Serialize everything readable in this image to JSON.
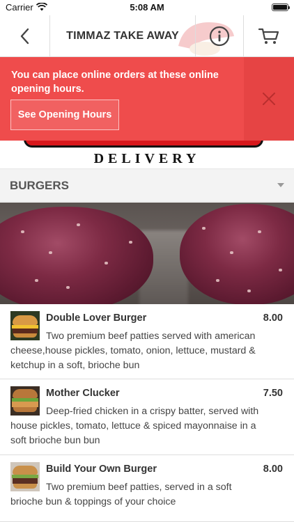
{
  "status_bar": {
    "carrier": "Carrier",
    "time": "5:08 AM"
  },
  "nav": {
    "title": "TIMMAZ TAKE AWAY",
    "back_icon": "chevron-left-icon",
    "info_icon": "info-circle-icon",
    "cart_icon": "cart-icon"
  },
  "banner": {
    "logo_text": "DELIVERY",
    "accent_color": "#d8181c"
  },
  "alert": {
    "message": "You can place online orders at these online opening hours.",
    "button_label": "See Opening Hours",
    "close_icon": "close-icon",
    "background": "#ef4c4c"
  },
  "category": {
    "title": "BURGERS",
    "chevron_icon": "chevron-down-icon"
  },
  "menu_items": [
    {
      "name": "Double Lover Burger",
      "price": "8.00",
      "description": "Two premium beef patties served with american cheese,house pickles, tomato, onion, lettuce, mustard & ketchup in a soft, brioche bun"
    },
    {
      "name": "Mother Clucker",
      "price": "7.50",
      "description": "Deep-fried chicken in a crispy batter, served with house pickles, tomato, lettuce & spiced mayonnaise in a soft brioche bun bun"
    },
    {
      "name": "Build Your Own Burger",
      "price": "8.00",
      "description": "Two premium beef patties, served in a soft brioche bun & toppings of your choice"
    }
  ]
}
